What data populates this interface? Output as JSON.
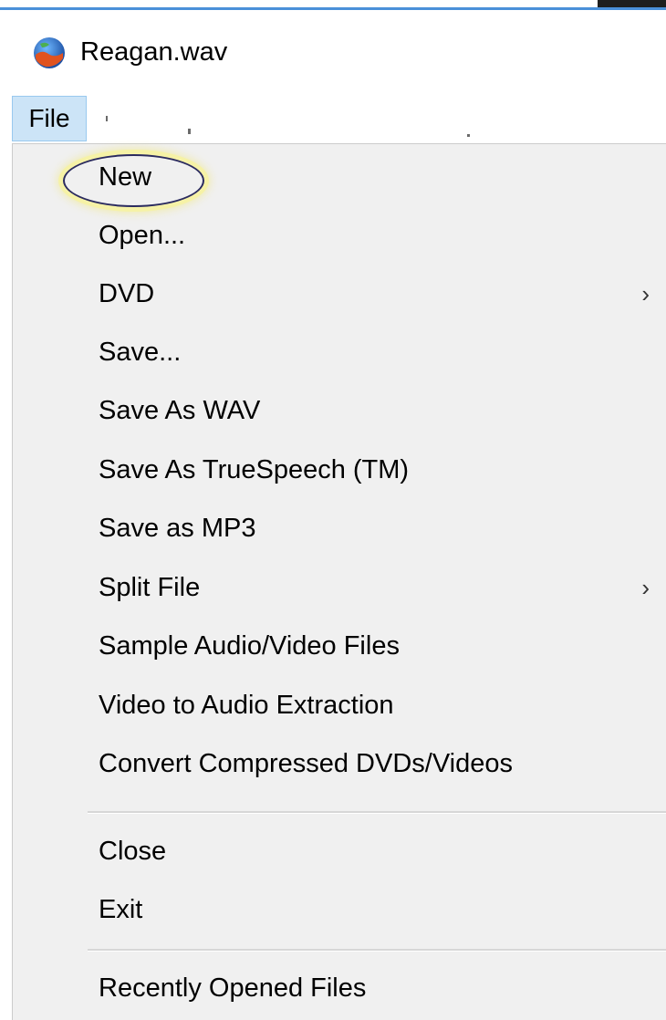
{
  "window": {
    "title": "Reagan.wav",
    "icon": "globe-app-icon"
  },
  "menubar": {
    "items": [
      {
        "label": "File",
        "active": true
      }
    ]
  },
  "file_menu": {
    "items": [
      {
        "label": "New",
        "submenu": false,
        "highlighted": true
      },
      {
        "label": "Open...",
        "submenu": false
      },
      {
        "label": "DVD",
        "submenu": true
      },
      {
        "label": "Save...",
        "submenu": false
      },
      {
        "label": "Save As WAV",
        "submenu": false
      },
      {
        "label": "Save As TrueSpeech (TM)",
        "submenu": false
      },
      {
        "label": "Save as MP3",
        "submenu": false
      },
      {
        "label": "Split File",
        "submenu": true
      },
      {
        "label": "Sample Audio/Video Files",
        "submenu": false
      },
      {
        "label": "Video to Audio Extraction",
        "submenu": false
      },
      {
        "label": "Convert Compressed DVDs/Videos",
        "submenu": false
      },
      {
        "label": "Close",
        "submenu": false
      },
      {
        "label": "Exit",
        "submenu": false
      },
      {
        "label": "Recently Opened Files",
        "submenu": false
      }
    ],
    "submenu_arrow": "›"
  },
  "colors": {
    "menu_background": "#f0f0f0",
    "active_menu_background": "#cce4f7",
    "active_menu_border": "#99c9ef",
    "highlight_ring": "#2b2b5e",
    "highlight_glow": "#f6f2a6"
  }
}
